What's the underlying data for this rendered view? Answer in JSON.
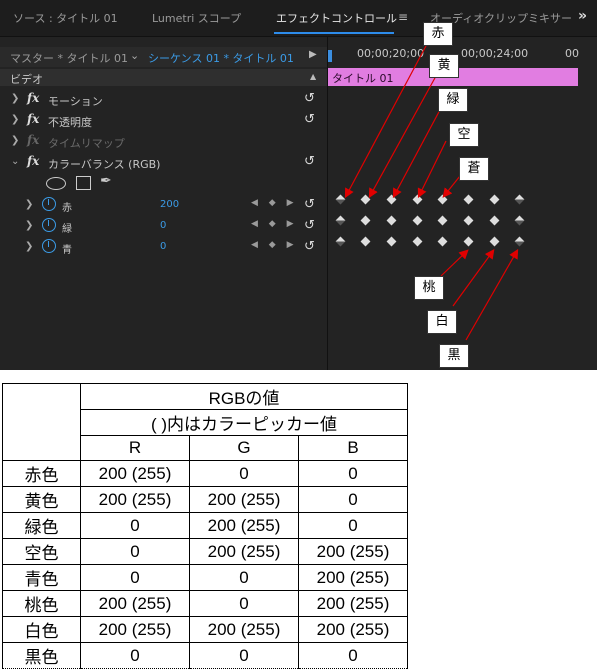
{
  "panel": {
    "tabs": [
      {
        "label": "ソース : タイトル 01"
      },
      {
        "label": "Lumetri スコープ"
      },
      {
        "label": "エフェクトコントロール"
      },
      {
        "label": "オーディオクリップミキサー"
      }
    ],
    "menu_glyph": "≡",
    "overflow_glyph": "»",
    "source_label": "マスター * タイトル 01",
    "sequence_label": "シーケンス 01 * タイトル 01",
    "timecodes": [
      "00;00;20;00",
      "00;00;24;00",
      "00"
    ],
    "clip_name": "タイトル 01",
    "section_title": "ビデオ",
    "effects": [
      {
        "label": "モーション",
        "enabled": true
      },
      {
        "label": "不透明度",
        "enabled": true
      },
      {
        "label": "タイムリマップ",
        "enabled": false
      },
      {
        "label": "カラーバランス (RGB)",
        "enabled": true
      }
    ],
    "params": [
      {
        "name": "赤",
        "value": "200"
      },
      {
        "name": "緑",
        "value": "0"
      },
      {
        "name": "青",
        "value": "0"
      }
    ],
    "fx_glyph": "fx",
    "reset_glyph": "↺",
    "nav_glyph": "◀ ◆ ▶",
    "callouts_top": [
      "赤",
      "黄",
      "緑",
      "空",
      "蒼"
    ],
    "callouts_bottom": [
      "桃",
      "白",
      "黒"
    ],
    "accent_color": "#2d8ceb",
    "clip_color": "#e17de1"
  },
  "table": {
    "title": "RGBの値",
    "subtitle": "(  )内はカラーピッカー値",
    "columns": [
      "R",
      "G",
      "B"
    ],
    "rows": [
      {
        "name": "赤色",
        "r": "200 (255)",
        "g": "0",
        "b": "0"
      },
      {
        "name": "黄色",
        "r": "200 (255)",
        "g": "200 (255)",
        "b": "0"
      },
      {
        "name": "緑色",
        "r": "0",
        "g": "200 (255)",
        "b": "0"
      },
      {
        "name": "空色",
        "r": "0",
        "g": "200 (255)",
        "b": "200 (255)"
      },
      {
        "name": "青色",
        "r": "0",
        "g": "0",
        "b": "200 (255)"
      },
      {
        "name": "桃色",
        "r": "200 (255)",
        "g": "0",
        "b": "200 (255)"
      },
      {
        "name": "白色",
        "r": "200 (255)",
        "g": "200 (255)",
        "b": "200 (255)"
      },
      {
        "name": "黒色",
        "r": "0",
        "g": "0",
        "b": "0"
      }
    ]
  }
}
